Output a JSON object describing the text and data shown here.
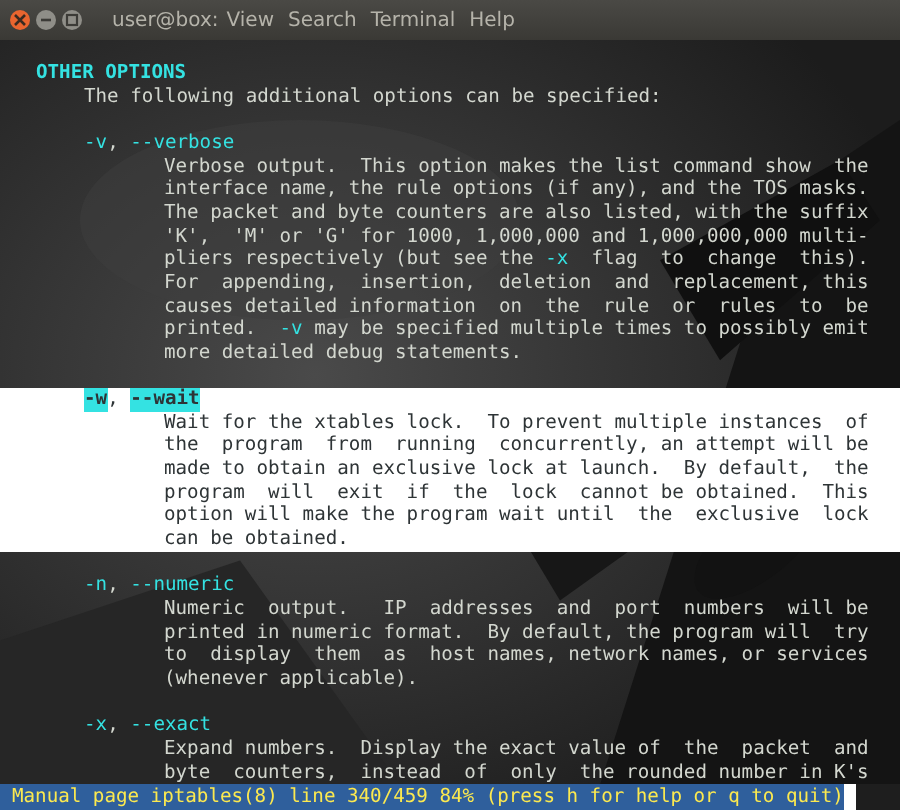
{
  "window": {
    "title": "user@box:",
    "menu": [
      "View",
      "Search",
      "Terminal",
      "Help"
    ]
  },
  "man_page": {
    "section_heading": "OTHER OPTIONS",
    "intro": "The following additional options can be specified:",
    "flag_separator": ",",
    "options": [
      {
        "flags": [
          "-v",
          "--verbose"
        ],
        "highlighted": false,
        "description": [
          "Verbose output.  This option makes the list command show  the",
          "interface name, the rule options (if any), and the TOS masks.",
          "The packet and byte counters are also listed, with the suffix",
          "'K',  'M' or 'G' for 1000, 1,000,000 and 1,000,000,000 multi-",
          "pliers respectively (but see the **-x**  flag  to  change  this).",
          "For  appending,  insertion,  deletion  and  replacement, this",
          "causes detailed information  on  the  rule  or  rules  to  be",
          "printed.  **-v** may be specified multiple times to possibly emit",
          "more detailed debug statements."
        ]
      },
      {
        "flags": [
          "-w",
          "--wait"
        ],
        "highlighted": true,
        "description": [
          "Wait for the xtables lock.  To prevent multiple instances  of",
          "the  program  from  running  concurrently, an attempt will be",
          "made to obtain an exclusive lock at launch.  By default,  the",
          "program  will  exit  if  the  lock  cannot be obtained.  This",
          "option will make the program wait until  the  exclusive  lock",
          "can be obtained."
        ]
      },
      {
        "flags": [
          "-n",
          "--numeric"
        ],
        "highlighted": false,
        "description": [
          "Numeric  output.   IP  addresses  and  port  numbers  will be",
          "printed in numeric format.  By default, the program will  try",
          "to  display  them  as  host names, network names, or services",
          "(whenever applicable)."
        ]
      },
      {
        "flags": [
          "-x",
          "--exact"
        ],
        "highlighted": false,
        "description": [
          "Expand numbers.  Display the exact value of  the  packet  and",
          "byte  counters,  instead  of  only  the rounded number in K's"
        ]
      }
    ]
  },
  "status_bar": {
    "text": "Manual page iptables(8) line 340/459 84% (press h for help or q to quit)"
  }
}
